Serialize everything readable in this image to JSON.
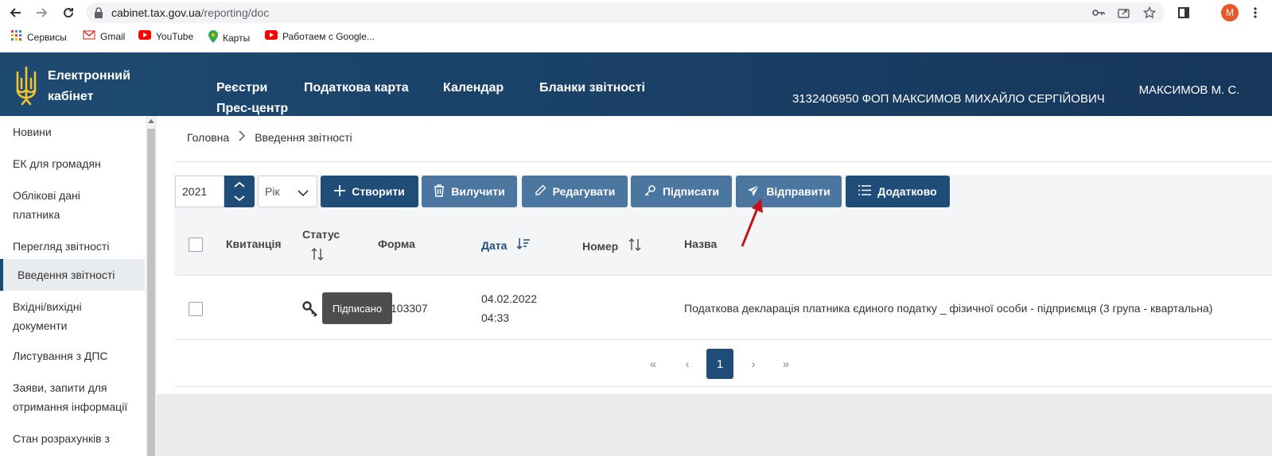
{
  "browser": {
    "url_host": "cabinet.tax.gov.ua",
    "url_path": "/reporting/doc",
    "profile_initial": "M"
  },
  "bookmarks": [
    {
      "label": "Сервисы",
      "icon": "apps-grid-icon"
    },
    {
      "label": "Gmail",
      "icon": "gmail-icon"
    },
    {
      "label": "YouTube",
      "icon": "youtube-icon"
    },
    {
      "label": "Карты",
      "icon": "maps-pin-icon"
    },
    {
      "label": "Работаем с Google...",
      "icon": "youtube-icon"
    }
  ],
  "header": {
    "brand": "Електронний кабінет",
    "nav": [
      "Реєстри",
      "Податкова карта",
      "Календар",
      "Бланки звітності",
      "Прес-центр"
    ],
    "taxpayer": "3132406950 ФОП МАКСИМОВ МИХАЙЛО СЕРГІЙОВИЧ",
    "user": "МАКСИМОВ М. С."
  },
  "sidebar": {
    "items": [
      {
        "label": "Новини"
      },
      {
        "label": "ЕК для громадян"
      },
      {
        "label": "Облікові дані платника"
      },
      {
        "label": "Перегляд звітності"
      },
      {
        "label": "Введення звітності",
        "active": true
      },
      {
        "label": "Вхідні/вихідні документи"
      },
      {
        "label": "Листування з ДПС"
      },
      {
        "label": "Заяви, запити для отримання інформації"
      },
      {
        "label": "Стан розрахунків з"
      }
    ]
  },
  "breadcrumb": {
    "home": "Головна",
    "current": "Введення звітності"
  },
  "toolbar": {
    "year": "2021",
    "period": "Рік",
    "buttons": {
      "create": "Створити",
      "delete": "Вилучити",
      "edit": "Редагувати",
      "sign": "Підписати",
      "send": "Відправити",
      "more": "Додатково"
    }
  },
  "table": {
    "headers": {
      "receipt": "Квитанція",
      "status": "Статус",
      "form": "Форма",
      "date": "Дата",
      "number": "Номер",
      "name": "Назва"
    },
    "rows": [
      {
        "receipt": "",
        "status_icon": "key-icon",
        "form": "F0103307",
        "form_visible": "103307",
        "date": "04.02.2022",
        "time": "04:33",
        "number": "",
        "name": "Податкова декларація платника єдиного податку _ фізичної особи - підприємця (3 група - квартальна)"
      }
    ]
  },
  "tooltip": "Підписано",
  "pagination": {
    "first": "«",
    "prev": "‹",
    "current": "1",
    "next": "›",
    "last": "»"
  },
  "colors": {
    "primary": "#1f4d78",
    "secondary": "#4a76a0",
    "header_bg": "#1e4a72",
    "annotation_arrow": "#c0121a"
  }
}
